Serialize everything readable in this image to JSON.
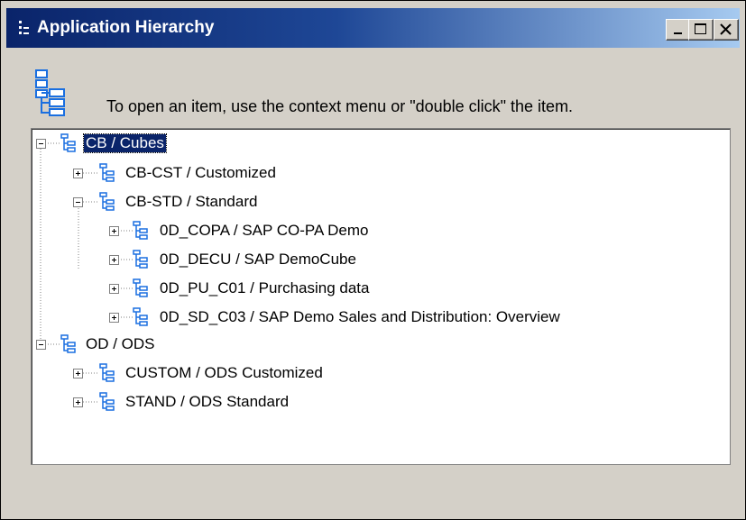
{
  "window": {
    "title": "Application Hierarchy",
    "buttons": {
      "minimize": "minimize",
      "maximize": "maximize",
      "close": "close"
    }
  },
  "hint": {
    "icon": "hierarchy-icon",
    "text": "To open an item, use the context menu or \"double click\" the item."
  },
  "tree": {
    "nodes": [
      {
        "id": "cb",
        "label": "CB / Cubes",
        "level": 0,
        "expanded": true,
        "selected": true
      },
      {
        "id": "cb-cst",
        "label": "CB-CST / Customized",
        "level": 1,
        "expanded": false
      },
      {
        "id": "cb-std",
        "label": "CB-STD / Standard",
        "level": 1,
        "expanded": true
      },
      {
        "id": "0d-copa",
        "label": "0D_COPA / SAP CO-PA Demo",
        "level": 2,
        "expanded": false
      },
      {
        "id": "0d-decu",
        "label": "0D_DECU / SAP DemoCube",
        "level": 2,
        "expanded": false
      },
      {
        "id": "0d-pu-c01",
        "label": "0D_PU_C01 / Purchasing data",
        "level": 2,
        "expanded": false
      },
      {
        "id": "0d-sd-c03",
        "label": "0D_SD_C03 / SAP Demo Sales and Distribution: Overview",
        "level": 2,
        "expanded": false
      },
      {
        "id": "od",
        "label": "OD / ODS",
        "level": 0,
        "expanded": true
      },
      {
        "id": "custom",
        "label": "CUSTOM / ODS Customized",
        "level": 1,
        "expanded": false
      },
      {
        "id": "stand",
        "label": "STAND / ODS Standard",
        "level": 1,
        "expanded": false
      }
    ]
  },
  "colors": {
    "titlebar_start": "#0a246a",
    "titlebar_end": "#a6caf0",
    "icon_blue": "#1a6fe0",
    "selection": "#0a246a"
  }
}
